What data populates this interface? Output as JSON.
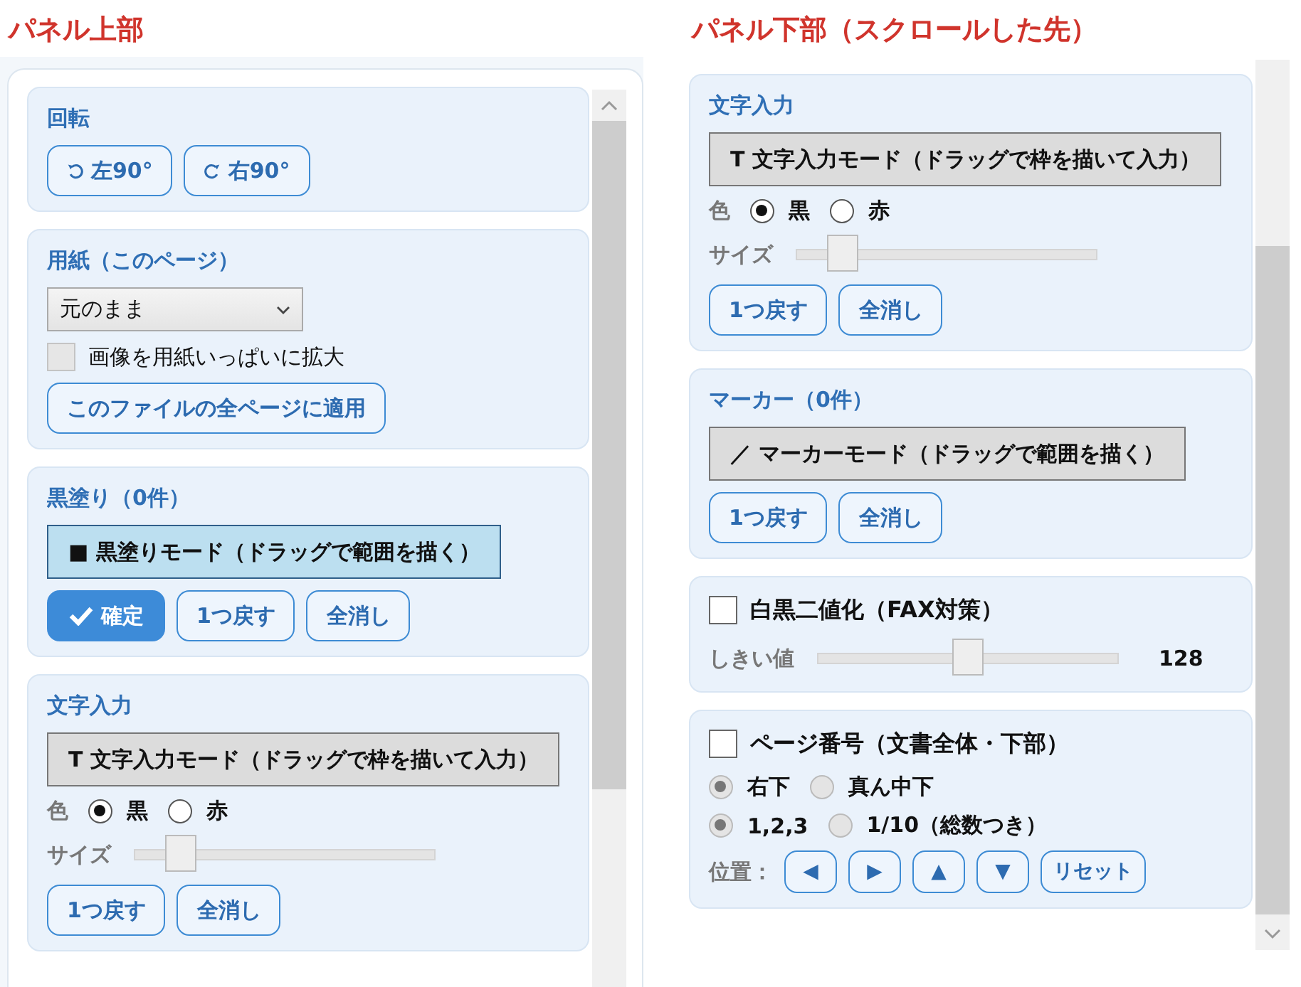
{
  "panels": [
    {
      "title": "パネル上部",
      "sections": [
        {
          "title": "回転",
          "rows": [
            {
              "kind": "rotate",
              "buttons": [
                {
                  "label": "左90°",
                  "primary": false
                },
                {
                  "label": "右90°",
                  "primary": false
                }
              ]
            }
          ]
        },
        {
          "title": "用紙（このページ）",
          "rows": [
            {
              "kind": "select",
              "value": "元のまま"
            },
            {
              "kind": "checkbox",
              "label": "画像を用紙いっぱいに拡大",
              "checked": false,
              "disabled": true
            },
            {
              "kind": "buttons",
              "buttons": [
                {
                  "label": "このファイルの全ページに適用",
                  "primary": false
                }
              ]
            }
          ]
        },
        {
          "title": "黒塗り（0件）",
          "rows": [
            {
              "kind": "mode",
              "label": "■ 黒塗りモード（ドラッグで範囲を描く）",
              "selected": true
            },
            {
              "kind": "buttons",
              "buttons": [
                {
                  "label": "確定",
                  "primary": true
                },
                {
                  "label": "1つ戻す",
                  "primary": false
                },
                {
                  "label": "全消し",
                  "primary": false
                }
              ]
            }
          ]
        },
        {
          "title": "文字入力",
          "rows": [
            {
              "kind": "mode",
              "label": "T 文字入力モード（ドラッグで枠を描いて入力）",
              "selected": false
            },
            {
              "kind": "radios",
              "label": "色",
              "disabled": false,
              "options": [
                {
                  "label": "黒",
                  "selected": true
                },
                {
                  "label": "赤",
                  "selected": false
                }
              ]
            },
            {
              "kind": "slider",
              "label": "サイズ",
              "level": 0.15
            },
            {
              "kind": "buttons",
              "buttons": [
                {
                  "label": "1つ戻す",
                  "primary": false
                },
                {
                  "label": "全消し",
                  "primary": false
                }
              ]
            }
          ]
        }
      ]
    },
    {
      "title": "パネル下部（スクロールした先）",
      "sections": [
        {
          "title": "文字入力",
          "rows": [
            {
              "kind": "mode",
              "label": "T 文字入力モード（ドラッグで枠を描いて入力）",
              "selected": false
            },
            {
              "kind": "radios",
              "label": "色",
              "disabled": false,
              "options": [
                {
                  "label": "黒",
                  "selected": true
                },
                {
                  "label": "赤",
                  "selected": false
                }
              ]
            },
            {
              "kind": "slider",
              "label": "サイズ",
              "level": 0.15
            },
            {
              "kind": "buttons",
              "buttons": [
                {
                  "label": "1つ戻す",
                  "primary": false
                },
                {
                  "label": "全消し",
                  "primary": false
                }
              ]
            }
          ]
        },
        {
          "title": "マーカー（0件）",
          "rows": [
            {
              "kind": "mode",
              "label": "／ マーカーモード（ドラッグで範囲を描く）",
              "selected": false
            },
            {
              "kind": "buttons",
              "buttons": [
                {
                  "label": "1つ戻す",
                  "primary": false
                },
                {
                  "label": "全消し",
                  "primary": false
                }
              ]
            }
          ]
        },
        {
          "title": "白黒二値化（FAX対策）",
          "checkbox": {
            "checked": false,
            "disabled": false
          },
          "rows": [
            {
              "kind": "slider",
              "label": "しきい値",
              "level": 0.5,
              "reading": "128"
            }
          ]
        },
        {
          "title": "ページ番号（文書全体・下部）",
          "checkbox": {
            "checked": false,
            "disabled": false
          },
          "rows": [
            {
              "kind": "radios",
              "disabled": true,
              "options": [
                {
                  "label": "右下",
                  "selected": true
                },
                {
                  "label": "真ん中下",
                  "selected": false
                }
              ]
            },
            {
              "kind": "radios",
              "disabled": true,
              "options": [
                {
                  "label": "1,2,3",
                  "selected": true
                },
                {
                  "label": "1/10（総数つき）",
                  "selected": false
                }
              ]
            },
            {
              "kind": "nudge",
              "label": "位置：",
              "buttons": [
                {
                  "label": "◀",
                  "primary": false
                },
                {
                  "label": "▶",
                  "primary": false
                },
                {
                  "label": "▲",
                  "primary": false
                },
                {
                  "label": "▼",
                  "primary": false
                },
                {
                  "label": "リセット",
                  "primary": false
                }
              ]
            }
          ]
        }
      ]
    }
  ]
}
